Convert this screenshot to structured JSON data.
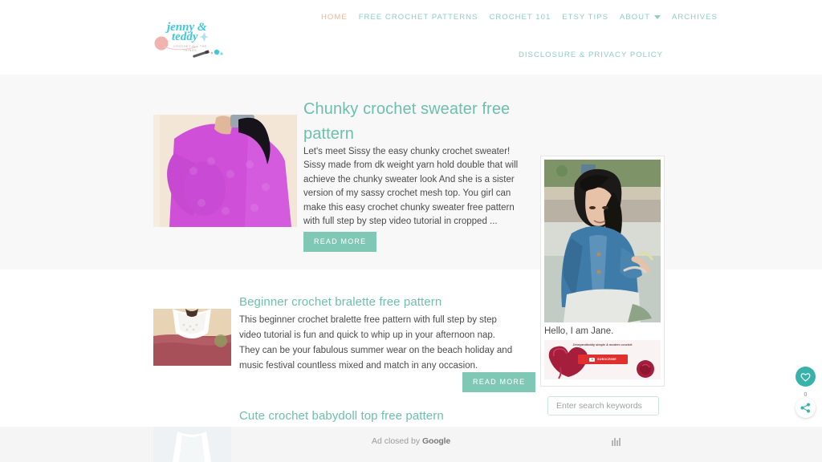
{
  "site": {
    "logo_name": "jenny & teddy",
    "logo_tagline": "CROCHET ALL THE THINGS",
    "accent_teal": "#6cc0ac",
    "accent_peach": "#f2b49a",
    "button_teal": "#7fc8b6"
  },
  "nav": {
    "primary": [
      {
        "label": "HOME",
        "active": true
      },
      {
        "label": "FREE CROCHET PATTERNS",
        "active": false
      },
      {
        "label": "CROCHET 101",
        "active": false
      },
      {
        "label": "ETSY TIPS",
        "active": false
      },
      {
        "label": "ABOUT",
        "active": false,
        "caret": true
      },
      {
        "label": "ARCHIVES",
        "active": false
      }
    ],
    "secondary": [
      {
        "label": "DISCLOSURE & PRIVACY POLICY"
      }
    ]
  },
  "posts": [
    {
      "title": "Chunky crochet sweater free pattern",
      "excerpt": "Let's meet Sissy the easy chunky crochet sweater! Sissy made from dk weight yarn hold double that will achieve the chunky sweater look And she is a sister version of my sassy crochet mesh top. You girl can make this easy crochet chunky sweater free pattern with full step by step video tutorial in cropped ...",
      "read_more": "READ MORE"
    },
    {
      "title": "Beginner crochet bralette free pattern",
      "excerpt": "This beginner crochet bralette free pattern with full step by step video tutorial is fun and quick to whip up in your afternoon nap. They can be your fabulous summer wear on the beach holiday and music festival countless mixed and match in any occasion.",
      "read_more": "READ MORE"
    },
    {
      "title": "Cute crochet babydoll top free pattern",
      "excerpt": "",
      "read_more": ""
    }
  ],
  "sidebar": {
    "about_text": "Hello, I am Jane.",
    "youtube_caption": "Jennyandteddy simple & modern crochet",
    "youtube_button": "SUBSCRIBE",
    "search_placeholder": "Enter search keywords"
  },
  "floating": {
    "like_count": "0"
  },
  "ad": {
    "closed_text": "Ad closed by ",
    "closed_brand": "Google"
  }
}
